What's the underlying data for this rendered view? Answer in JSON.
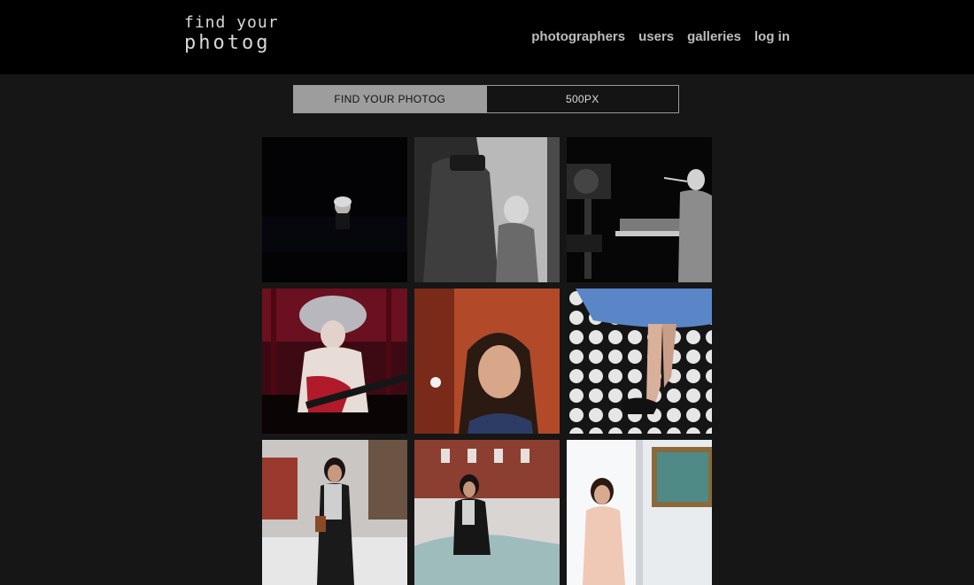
{
  "header": {
    "logo_line1": "find your",
    "logo_line2": "photog",
    "nav": [
      {
        "label": "photographers"
      },
      {
        "label": "users"
      },
      {
        "label": "galleries"
      },
      {
        "label": "log in"
      }
    ]
  },
  "tabs": [
    {
      "label": "FIND YOUR PHOTOG",
      "active": true
    },
    {
      "label": "500PX",
      "active": false
    }
  ],
  "colors": {
    "page_bg": "#161616",
    "header_bg": "#000000",
    "active_tab_bg": "#9d9d9d",
    "nav_text": "#bdbdbd"
  }
}
